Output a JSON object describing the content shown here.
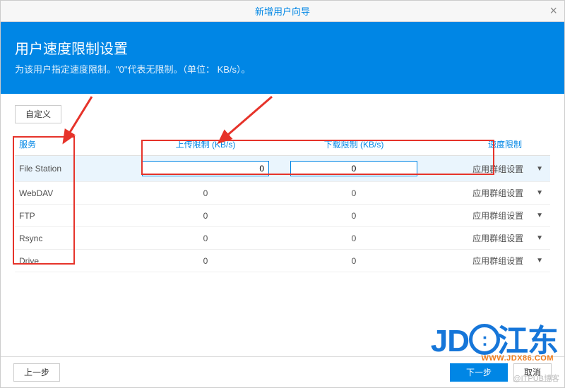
{
  "window": {
    "title": "新增用户向导",
    "close_label": "×"
  },
  "header": {
    "title": "用户速度限制设置",
    "subtitle": "为该用户指定速度限制。\"0\"代表无限制。（单位： KB/s）。"
  },
  "buttons": {
    "custom": "自定义",
    "prev": "上一步",
    "next": "下一步",
    "cancel": "取消"
  },
  "table": {
    "columns": {
      "service": "服务",
      "upload": "上传限制 (KB/s)",
      "download": "下载限制 (KB/s)",
      "limit": "速度限制"
    },
    "limit_label": "应用群组设置",
    "rows": [
      {
        "service": "File Station",
        "upload": "0",
        "download": "0",
        "editing": true
      },
      {
        "service": "WebDAV",
        "upload": "0",
        "download": "0",
        "editing": false
      },
      {
        "service": "FTP",
        "upload": "0",
        "download": "0",
        "editing": false
      },
      {
        "service": "Rsync",
        "upload": "0",
        "download": "0",
        "editing": false
      },
      {
        "service": "Drive",
        "upload": "0",
        "download": "0",
        "editing": false
      }
    ]
  },
  "watermark": {
    "brand_en": "JD",
    "brand_cn": "江东",
    "url": "WWW.JDX86.COM",
    "blog": "@ITPUB博客"
  }
}
